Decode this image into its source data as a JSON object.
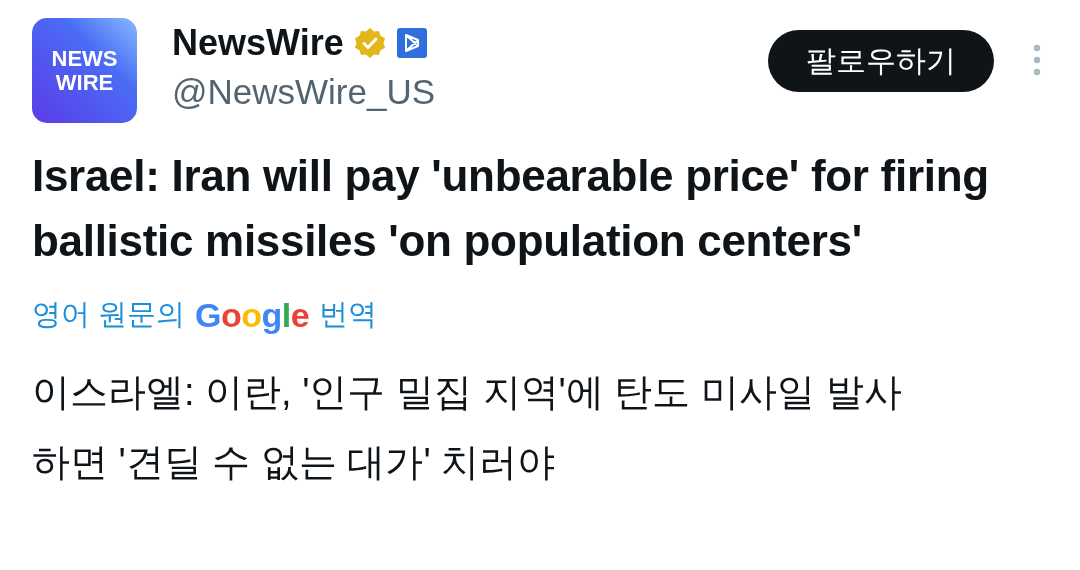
{
  "account": {
    "logo_text": [
      "NEWS",
      "WIRE"
    ],
    "name": "NewsWire",
    "verified": true,
    "affiliate": true,
    "handle": "@NewsWire_US"
  },
  "follow_button": {
    "label": "팔로우하기"
  },
  "post": {
    "text": "Israel: Iran will pay 'unbearable price' for firing ballistic missiles 'on population centers'"
  },
  "translation": {
    "prefix": "영어 원문의",
    "brand": "Google",
    "suffix": "번역",
    "text": "이스라엘: 이란, '인구 밀집 지역'에 탄도 미사일 발사하면 '견딜 수 없는 대가' 치러야"
  }
}
